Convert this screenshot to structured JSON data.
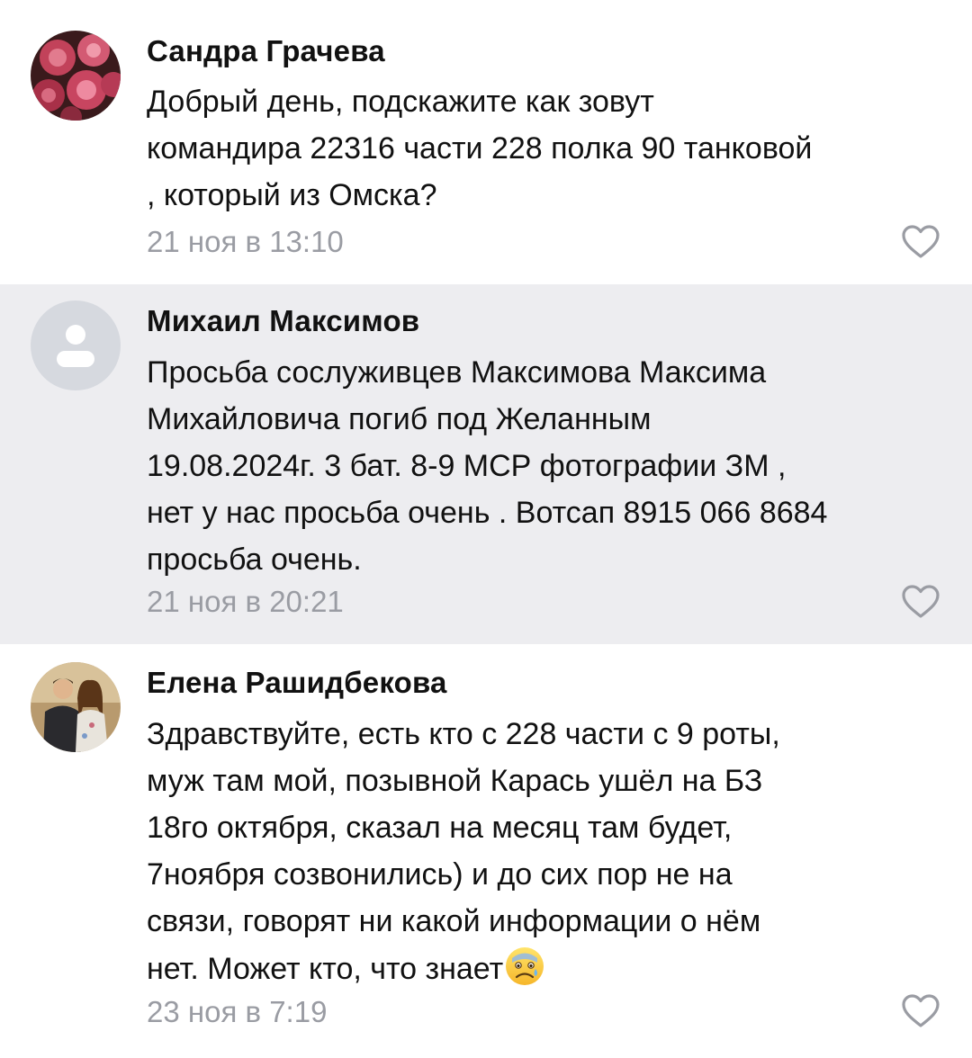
{
  "comments": [
    {
      "author": "Сандра Грачева",
      "avatar_icon": "roses-photo",
      "text": "Добрый день, подскажите как зовут\nкомандира 22316 части 228 полка 90 танковой\n, который из Омска?",
      "date": "21 ноя в 13:10"
    },
    {
      "author": "Михаил Максимов",
      "avatar_icon": "default-user-icon",
      "text": "Просьба сослуживцев Максимова Максима\nМихайловича погиб под Желанным\n19.08.2024г. 3 бат. 8-9 МСР фотографии ЗМ ,\nнет у нас просьба очень . Вотсап 8915 066 8684\nпросьба очень.",
      "date": "21 ноя в 20:21"
    },
    {
      "author": "Елена Рашидбекова",
      "avatar_icon": "couple-photo",
      "text": "Здравствуйте, есть кто с 228 части с 9 роты,\nмуж там мой, позывной Карась ушёл на БЗ\n18го октября, сказал на месяц там будет,\n7ноября созвонились) и до сих пор не на\nсвязи, говорят ни какой информации о нём\nнет. Может кто, что знает",
      "emoji": "anxious-face-emoji",
      "date": "23 ноя в 7:19"
    }
  ],
  "colors": {
    "highlight_background": "#ededf0",
    "date_text": "#9a9ca3",
    "like_icon": "#9a9ca3"
  }
}
